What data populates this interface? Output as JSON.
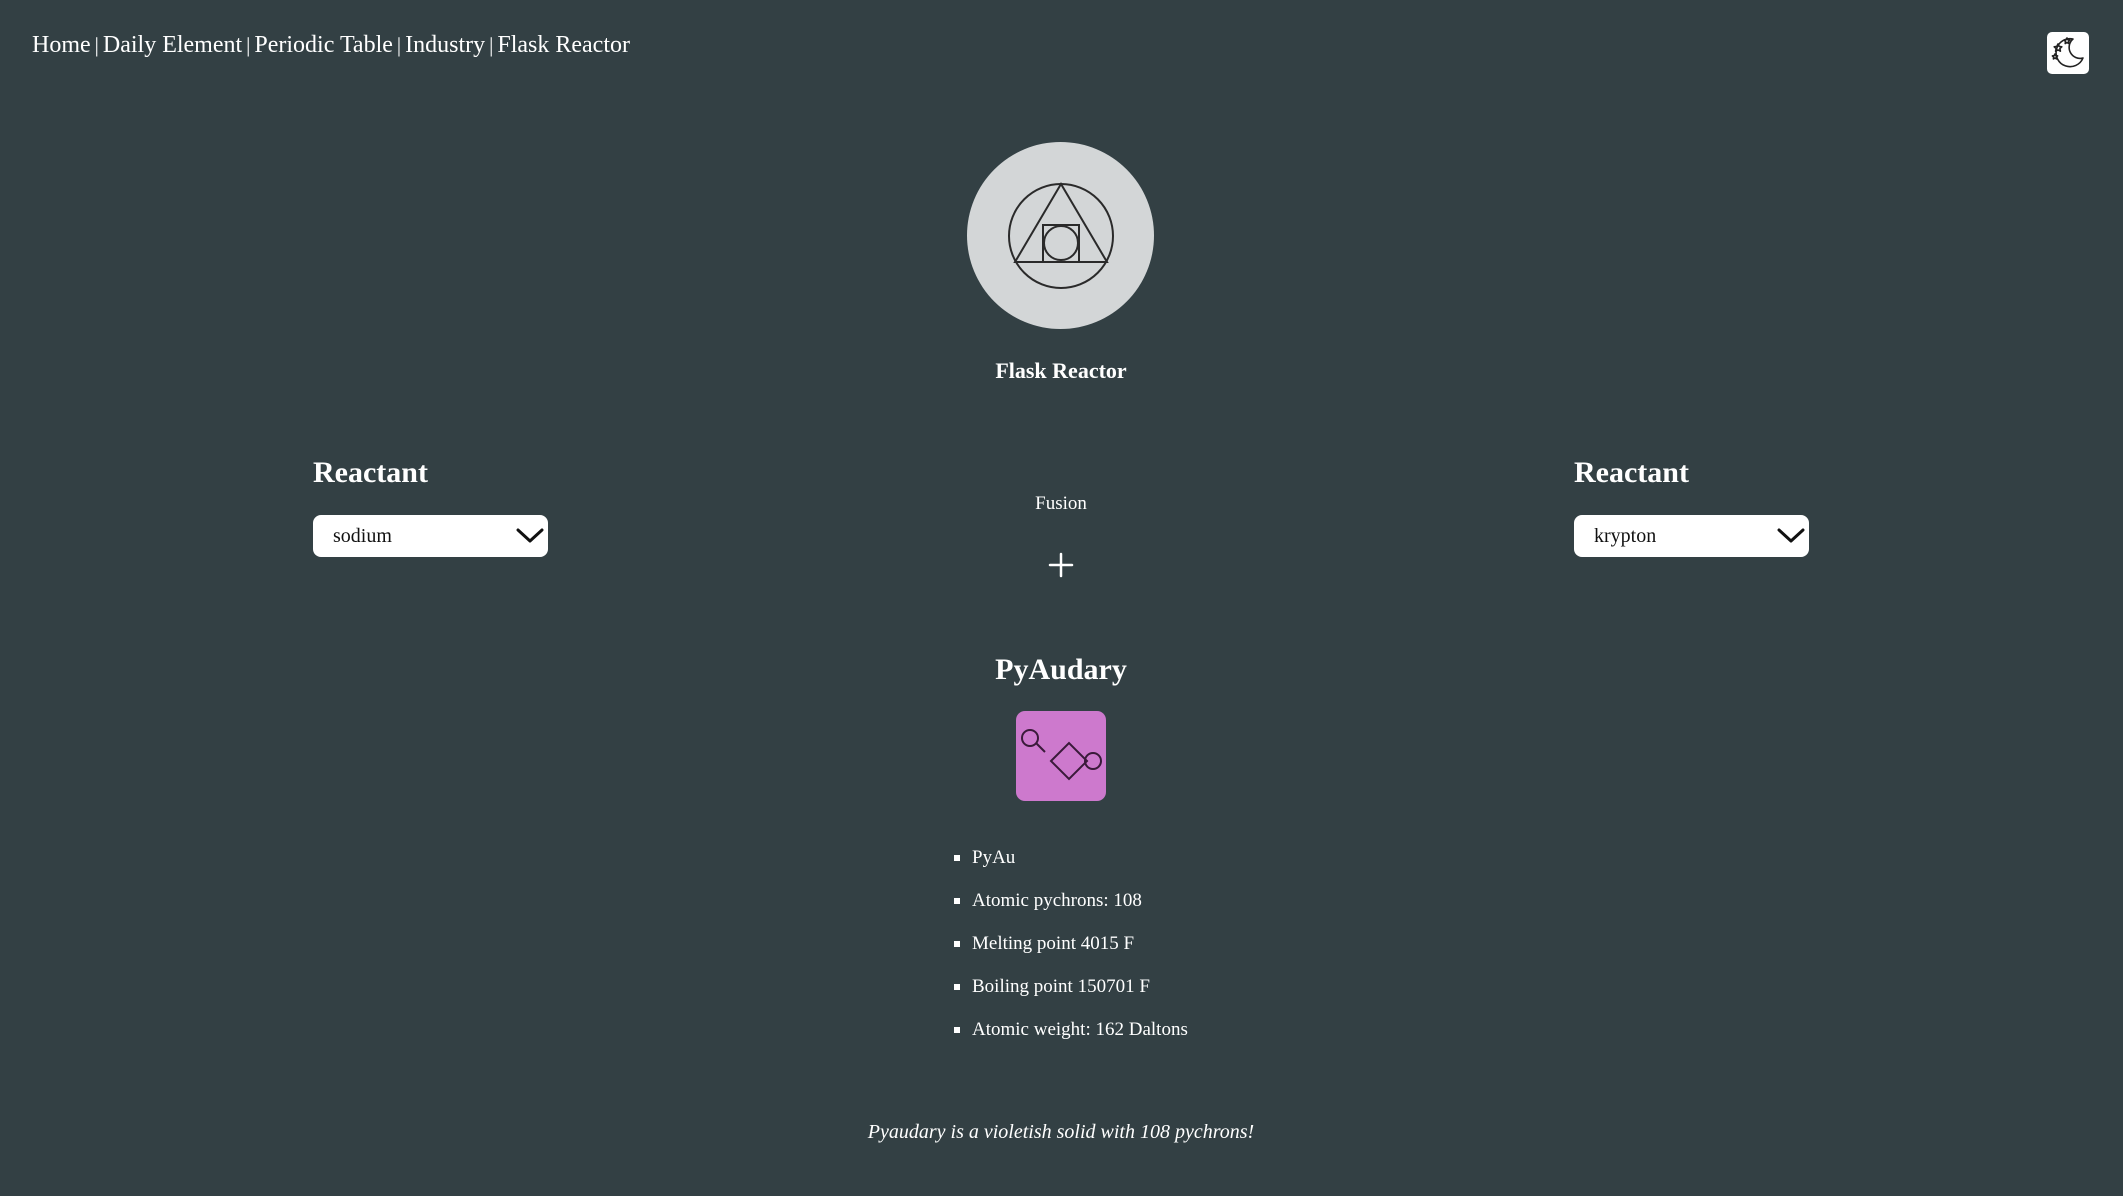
{
  "nav": {
    "items": [
      {
        "label": "Home"
      },
      {
        "label": "Daily Element"
      },
      {
        "label": "Periodic Table"
      },
      {
        "label": "Industry"
      },
      {
        "label": "Flask Reactor"
      }
    ],
    "separator": "|",
    "theme_toggle_icon": "moon-stars-icon"
  },
  "header": {
    "logo_icon": "alchemy-circle-triangle-square-icon",
    "title": "Flask Reactor"
  },
  "reactants": {
    "left": {
      "heading": "Reactant",
      "selected": "sodium"
    },
    "right": {
      "heading": "Reactant",
      "selected": "krypton"
    },
    "reaction_type": "Fusion",
    "operator_icon": "plus-icon"
  },
  "product": {
    "name": "PyAudary",
    "icon": "diamond-circuit-icon",
    "icon_bg": "#cd79cd",
    "properties": [
      "PyAu",
      "Atomic pychrons: 108",
      "Melting point 4015 F",
      "Boiling point 150701 F",
      "Atomic weight: 162 Daltons"
    ],
    "description": "Pyaudary is a violetish solid with 108 pychrons!"
  },
  "colors": {
    "background": "#334044",
    "text": "#ffffff",
    "logo_bg": "#d3d6d7"
  }
}
